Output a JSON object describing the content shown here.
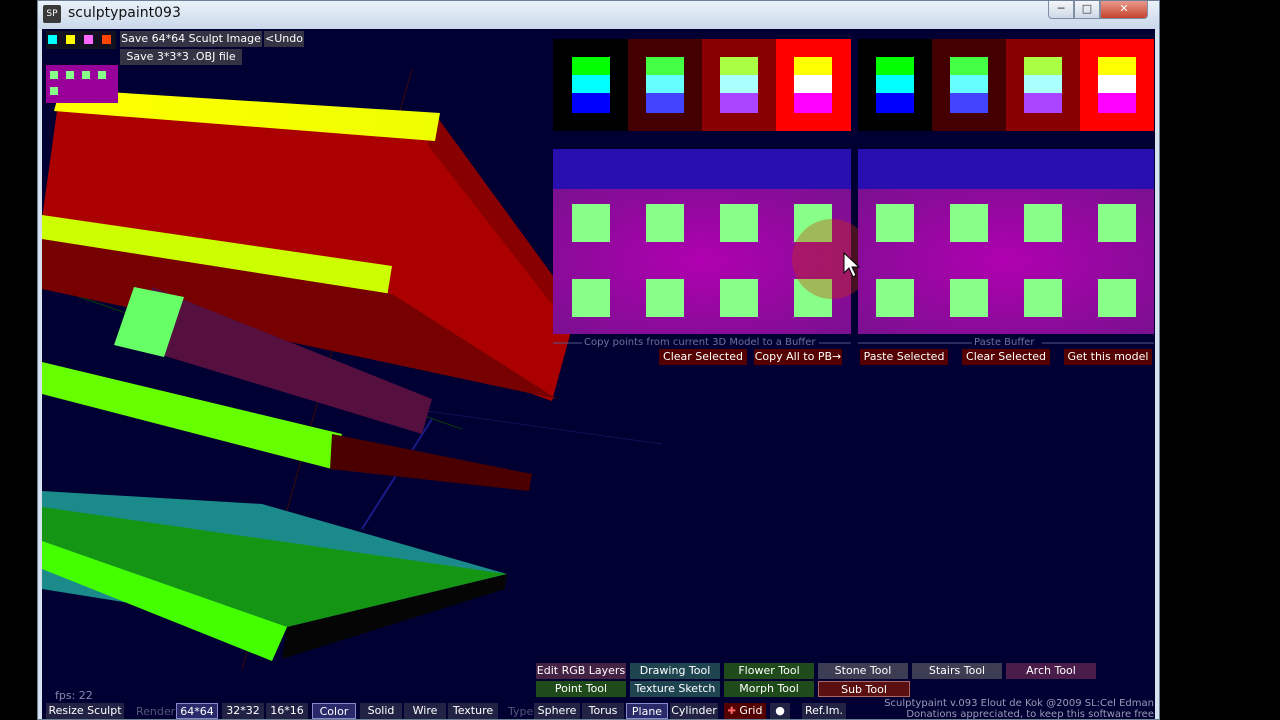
{
  "window": {
    "title": "sculptypaint093",
    "icon_text": "SP",
    "min_label": "─",
    "max_label": "□",
    "close_label": "✕"
  },
  "top": {
    "save_image": "Save 64*64 Sculpt Image",
    "undo": "<Undo",
    "save_obj": "Save  3*3*3 .OBJ file"
  },
  "buffers": {
    "copy_caption": "Copy points from current 3D Model to a Buffer",
    "paste_caption": "Paste Buffer",
    "clear_selected_left": "Clear Selected",
    "copy_all": "Copy All to PB→",
    "paste_selected": "Paste Selected",
    "clear_selected_right": "Clear Selected",
    "get_model": "Get this model"
  },
  "tools": {
    "row1": [
      "Edit RGB Layers",
      "Drawing Tool",
      "Flower Tool",
      "Stone Tool",
      "Stairs Tool",
      "Arch Tool"
    ],
    "row2": [
      "Point Tool",
      "Texture Sketch",
      "Morph Tool",
      "Sub Tool"
    ]
  },
  "bottom": {
    "fps": "fps: 22",
    "resize": "Resize Sculpt",
    "render_label": "Render",
    "sizes": [
      "64*64",
      "32*32",
      "16*16"
    ],
    "modes": [
      "Color",
      "Solid",
      "Wire",
      "Texture"
    ],
    "type_label": "Type",
    "types": [
      "Sphere",
      "Torus",
      "Plane",
      "Cylinder"
    ],
    "grid": "Grid",
    "ref": "Ref.Im.",
    "credit_line1": "Sculptypaint v.093 Elout de Kok @2009  SL:Cel Edman",
    "credit_line2": "Donations appreciated, to keep this software free"
  },
  "colors": {
    "background": "#000033",
    "accent_red": "#cc0000",
    "accent_yellow": "#ffff00",
    "accent_green": "#66ff00"
  }
}
